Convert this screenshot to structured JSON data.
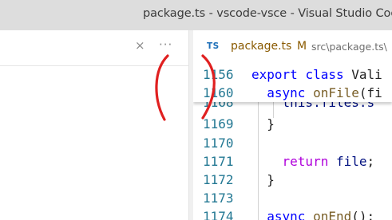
{
  "window": {
    "title": "package.ts - vscode-vsce - Visual Studio Code -"
  },
  "left_pane": {
    "close_glyph": "×",
    "more_glyph": "···"
  },
  "tab": {
    "icon_label": "TS",
    "name": "package.ts",
    "status": "M",
    "path": "src\\package.ts\\"
  },
  "editor": {
    "sticky_lines": [
      {
        "number": "1156",
        "text": "export class Vali"
      },
      {
        "number": "1160",
        "text": "  async onFile(fi"
      }
    ],
    "lines": [
      {
        "number": "1168",
        "text": "    this.files.s"
      },
      {
        "number": "1169",
        "text": "  }"
      },
      {
        "number": "1170",
        "text": ""
      },
      {
        "number": "1171",
        "text": "    return file;"
      },
      {
        "number": "1172",
        "text": "  }"
      },
      {
        "number": "1173",
        "text": ""
      },
      {
        "number": "1174",
        "text": "  async onEnd():"
      }
    ]
  },
  "annotation": {
    "color": "#e02020",
    "shape": "red-parentheses"
  },
  "colors": {
    "keyword_blue": "#0000ff",
    "control_purple": "#af00db",
    "function_yellow": "#795e26",
    "line_number": "#237893",
    "modified_tab": "#8a5a00"
  }
}
